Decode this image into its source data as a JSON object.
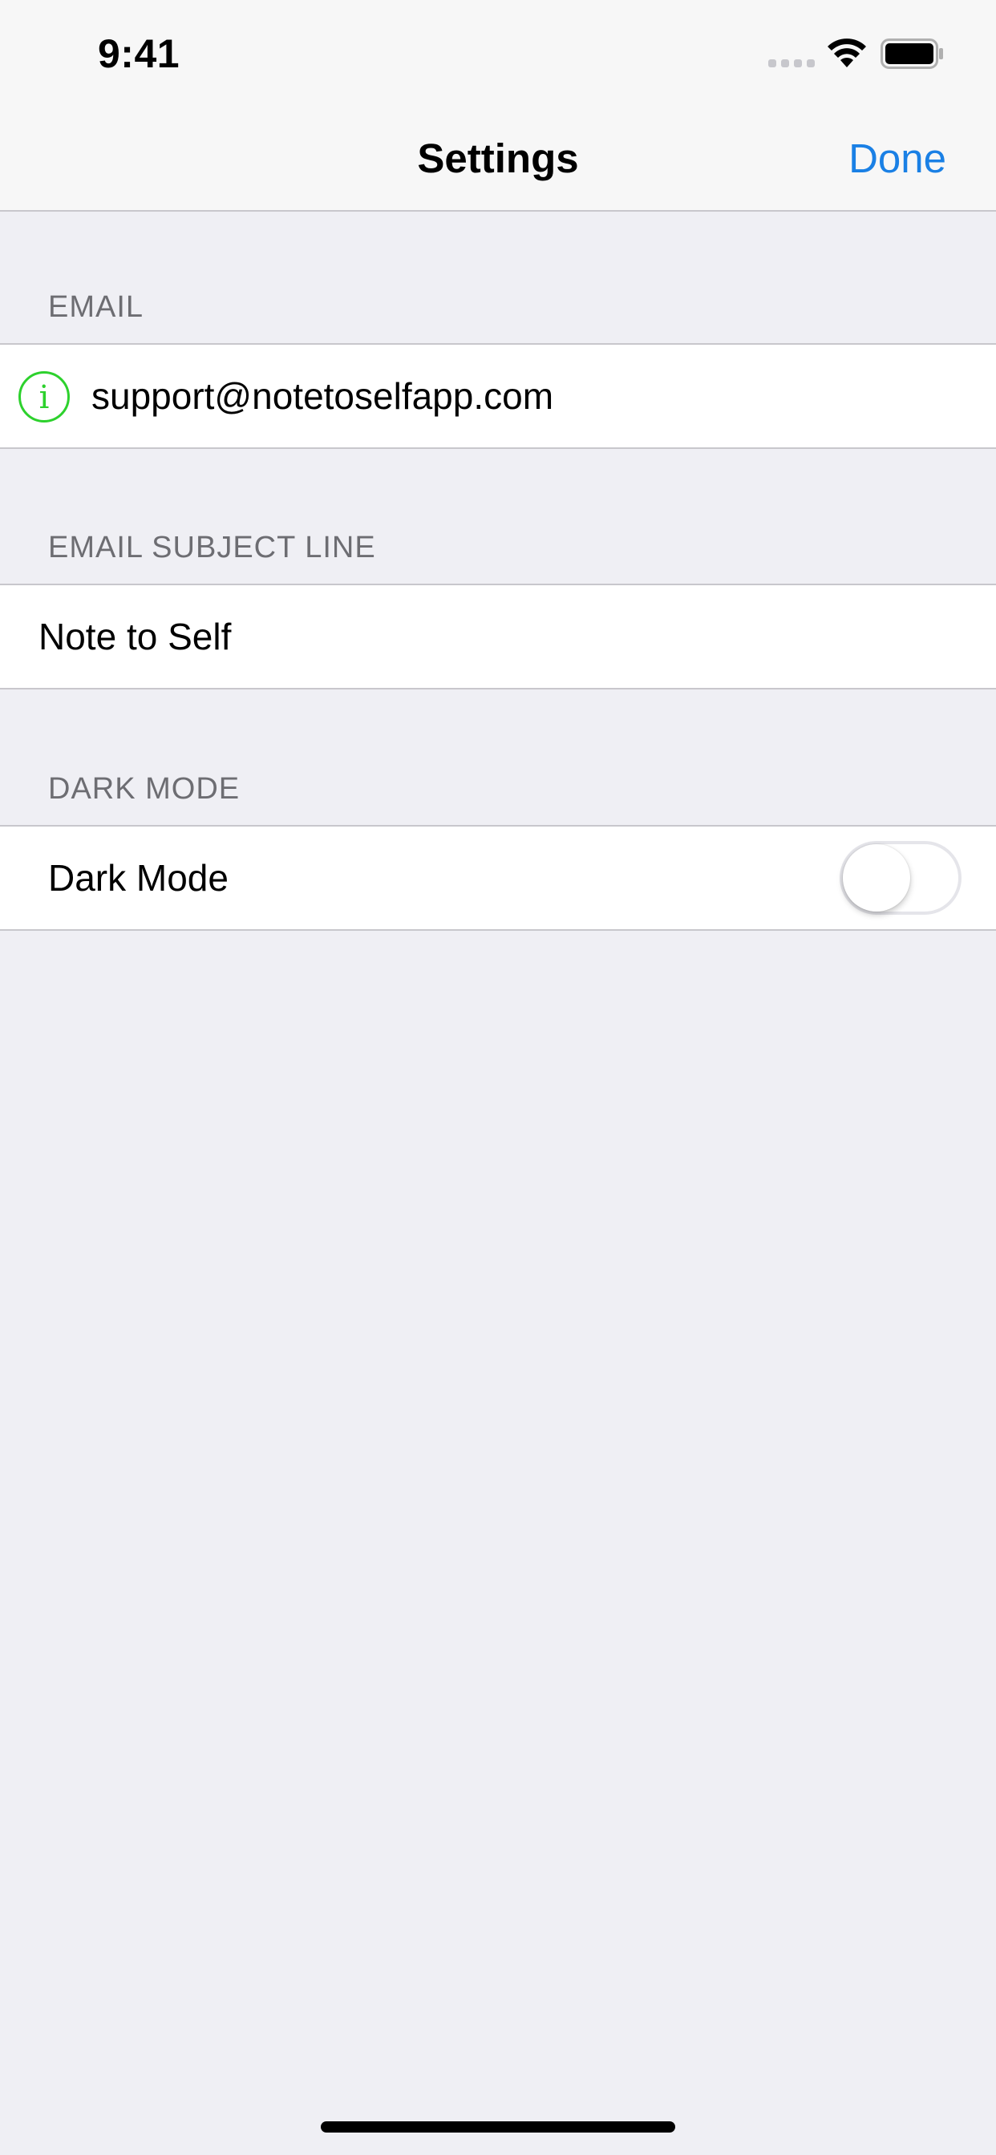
{
  "status_bar": {
    "time": "9:41"
  },
  "nav": {
    "title": "Settings",
    "done_label": "Done"
  },
  "sections": {
    "email": {
      "header": "EMAIL",
      "value": "support@notetoselfapp.com",
      "icon": "info-icon",
      "icon_color": "#2dd12d"
    },
    "subject": {
      "header": "EMAIL SUBJECT LINE",
      "value": "Note to Self"
    },
    "dark_mode": {
      "header": "DARK MODE",
      "label": "Dark Mode",
      "enabled": false
    }
  },
  "colors": {
    "accent": "#1a80e5",
    "background": "#efeff4",
    "section_text": "#6d6d72"
  }
}
